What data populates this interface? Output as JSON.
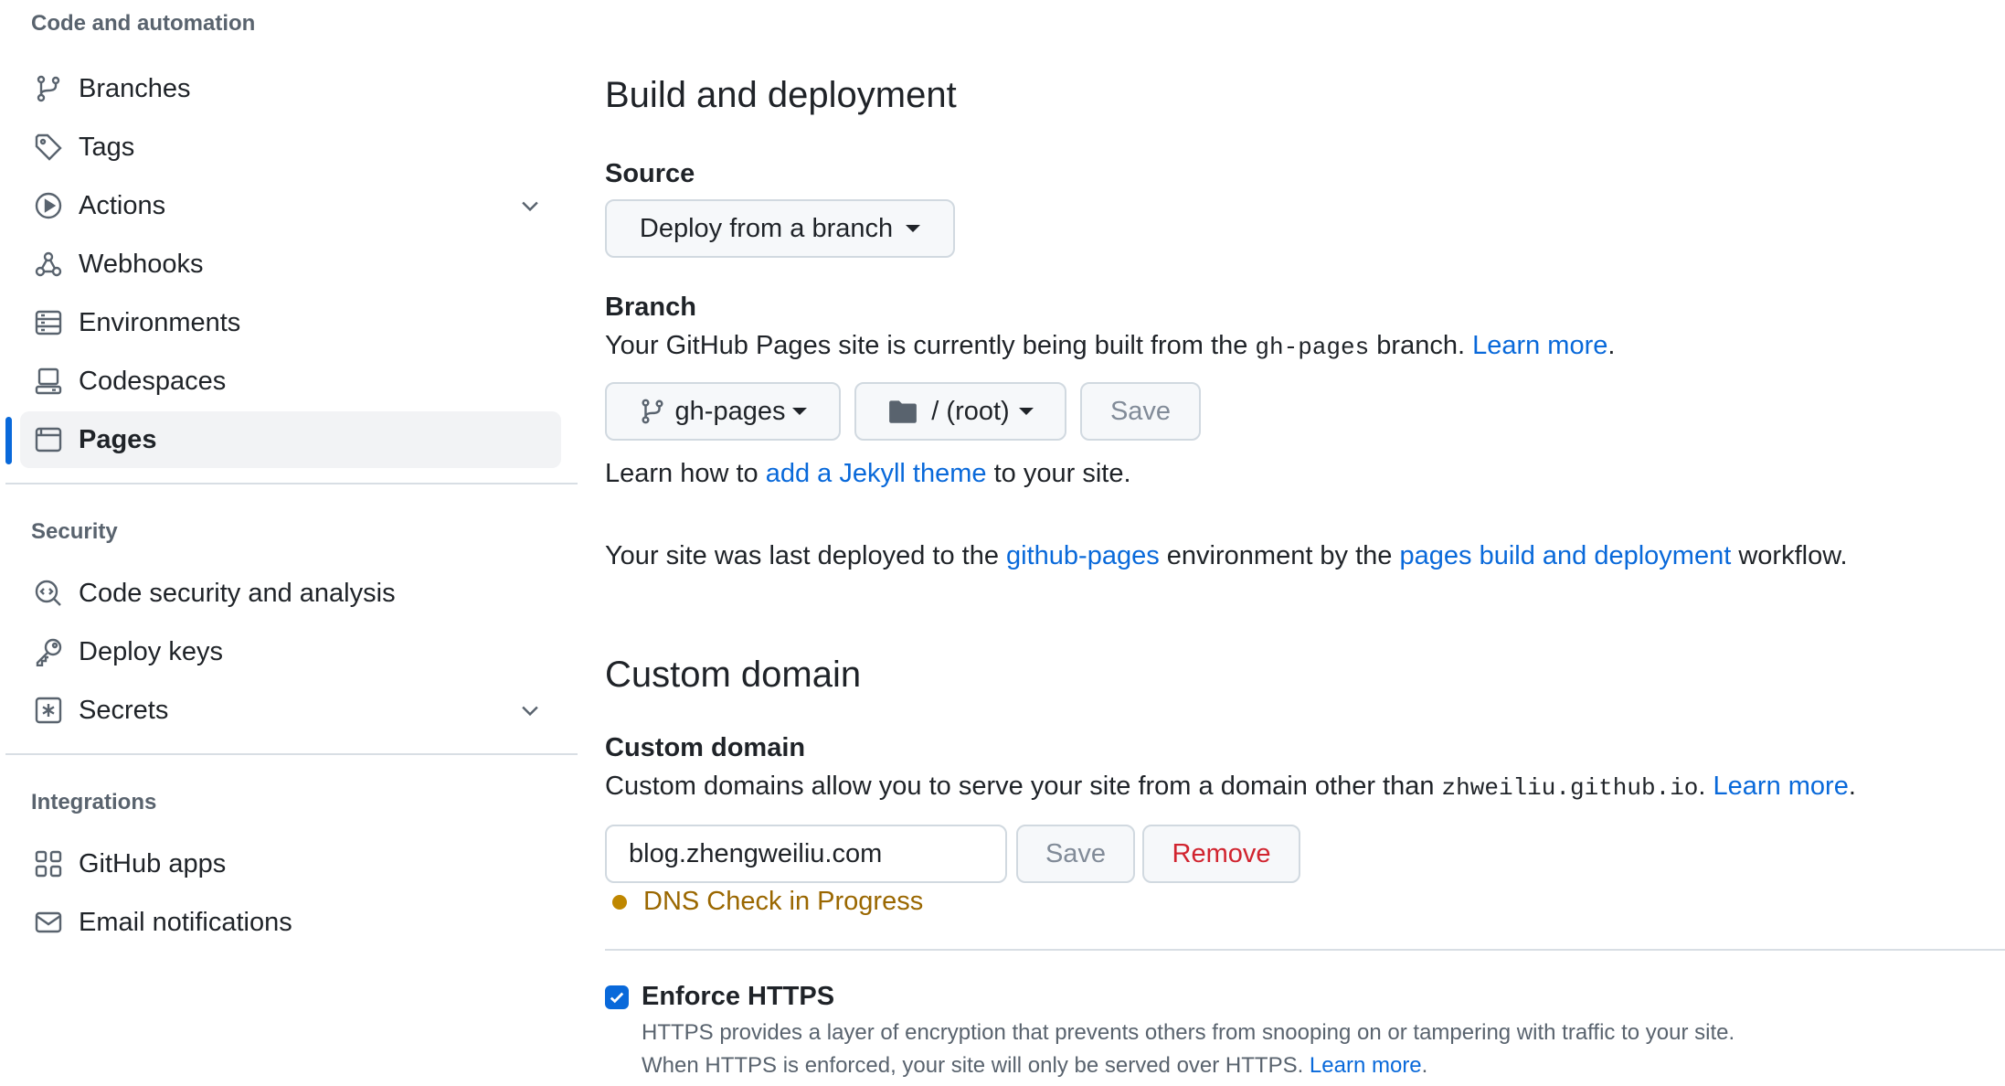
{
  "sidebar": {
    "sections": [
      {
        "heading": "Code and automation"
      },
      {
        "heading": "Security"
      },
      {
        "heading": "Integrations"
      }
    ],
    "items": [
      {
        "label": "Branches",
        "icon": "git-branch-icon"
      },
      {
        "label": "Tags",
        "icon": "tag-icon"
      },
      {
        "label": "Actions",
        "icon": "play-icon"
      },
      {
        "label": "Webhooks",
        "icon": "webhook-icon"
      },
      {
        "label": "Environments",
        "icon": "server-icon"
      },
      {
        "label": "Codespaces",
        "icon": "codespaces-icon"
      },
      {
        "label": "Pages",
        "icon": "browser-icon",
        "active": true
      },
      {
        "label": "Code security and analysis",
        "icon": "codescan-icon"
      },
      {
        "label": "Deploy keys",
        "icon": "key-icon"
      },
      {
        "label": "Secrets",
        "icon": "key-asterisk-icon"
      },
      {
        "label": "GitHub apps",
        "icon": "apps-icon"
      },
      {
        "label": "Email notifications",
        "icon": "mail-icon"
      }
    ]
  },
  "build": {
    "title": "Build and deployment",
    "source_label": "Source",
    "source_value": "Deploy from a branch",
    "branch_label": "Branch",
    "branch_desc_prefix": "Your GitHub Pages site is currently being built from the ",
    "branch_desc_code": "gh-pages",
    "branch_desc_suffix": " branch. ",
    "learn_more": "Learn more",
    "period": ".",
    "branch_value": "gh-pages",
    "folder_value": "/ (root)",
    "save_label": "Save",
    "jekyll_prefix": "Learn how to ",
    "jekyll_link": "add a Jekyll theme",
    "jekyll_suffix": " to your site.",
    "deployed_prefix": "Your site was last deployed to the ",
    "deployed_env_link": "github-pages",
    "deployed_mid": " environment by the ",
    "deployed_workflow_link": "pages build and deployment",
    "deployed_suffix": " workflow."
  },
  "custom_domain": {
    "title": "Custom domain",
    "label": "Custom domain",
    "desc_prefix": "Custom domains allow you to serve your site from a domain other than ",
    "desc_code": "zhweiliu.github.io",
    "desc_suffix": ". ",
    "learn_more": "Learn more",
    "period": ".",
    "input_value": "blog.zhengweiliu.com",
    "save_label": "Save",
    "remove_label": "Remove",
    "status": "DNS Check in Progress"
  },
  "https": {
    "label": "Enforce HTTPS",
    "checked": true,
    "desc_line1": "HTTPS provides a layer of encryption that prevents others from snooping on or tampering with traffic to your site.",
    "desc_line2_prefix": "When HTTPS is enforced, your site will only be served over HTTPS. ",
    "learn_more": "Learn more",
    "period": "."
  },
  "colors": {
    "accent": "#0969da",
    "danger": "#d1242f",
    "attention": "#9a6700"
  }
}
